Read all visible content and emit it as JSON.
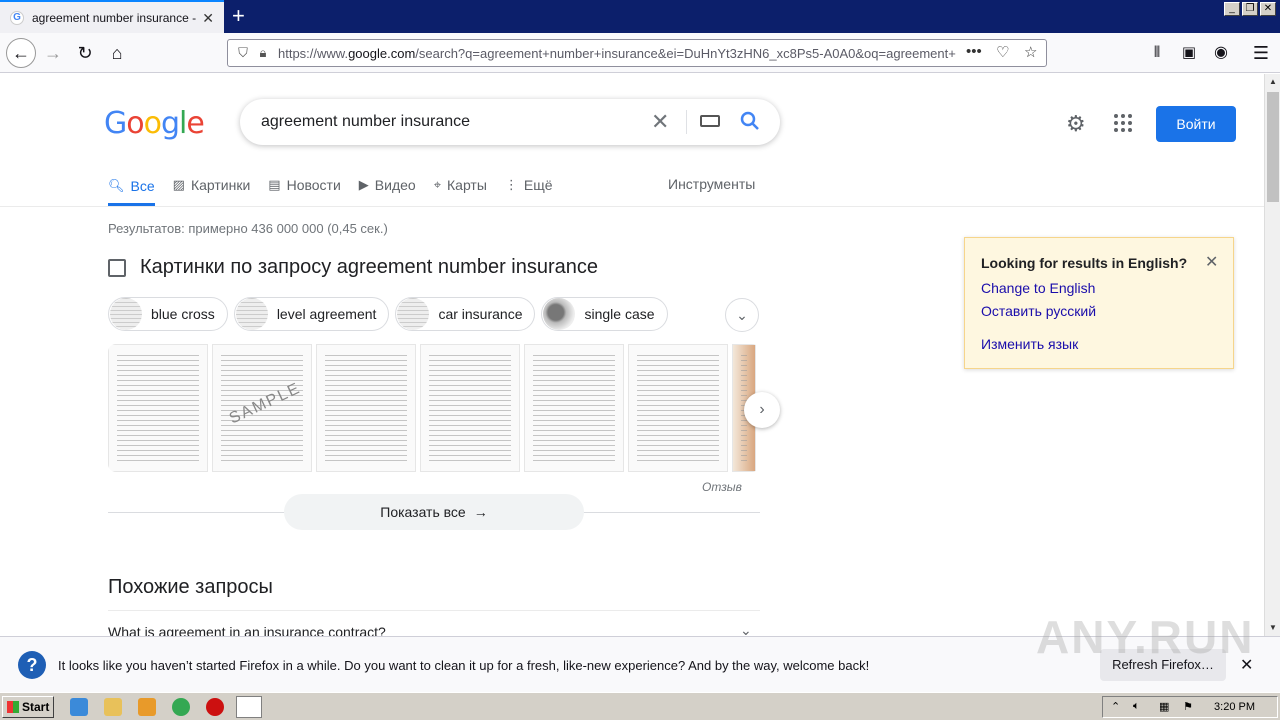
{
  "browser": {
    "tab_title": "agreement number insurance - По",
    "tab_favicon": "G",
    "new_tab": "+",
    "url_prefix": "https://www.",
    "url_domain": "google.com",
    "url_rest": "/search?q=agreement+number+insurance&ei=DuHnYt3zHN6_xc8Ps5-A0A0&oq=agreement+",
    "more": "•••"
  },
  "google": {
    "logo": [
      "G",
      "o",
      "o",
      "g",
      "l",
      "e"
    ],
    "query": "agreement number insurance",
    "signin": "Войти",
    "tabs": [
      {
        "label": "Все",
        "icon": "search-icon"
      },
      {
        "label": "Картинки",
        "icon": "image-icon"
      },
      {
        "label": "Новости",
        "icon": "news-icon"
      },
      {
        "label": "Видео",
        "icon": "video-icon"
      },
      {
        "label": "Карты",
        "icon": "map-pin-icon"
      },
      {
        "label": "Ещё",
        "icon": "more-vert-icon"
      }
    ],
    "tools": "Инструменты",
    "stats": "Результатов: примерно 436 000 000 (0,45 сек.)",
    "images_heading": "Картинки по запросу agreement number insurance",
    "chips": [
      "blue cross",
      "level agreement",
      "car insurance",
      "single case"
    ],
    "feedback": "Отзыв",
    "show_all": "Показать все",
    "related_heading": "Похожие запросы",
    "related_q1": "What is agreement in an insurance contract?"
  },
  "lang_box": {
    "title": "Looking for results in English?",
    "change": "Change to English",
    "keep": "Оставить русский",
    "change_lang": "Изменить язык"
  },
  "notification": {
    "message": "It looks like you haven’t started Firefox in a while. Do you want to clean it up for a fresh, like-new experience? And by the way, welcome back!",
    "button": "Refresh Firefox…"
  },
  "watermark": "ANY.RUN",
  "taskbar": {
    "start": "Start",
    "clock": "3:20 PM"
  },
  "colors": {
    "accent": "#1a73e8",
    "link": "#1a0dab",
    "tabbar": "#0c1f6b"
  }
}
